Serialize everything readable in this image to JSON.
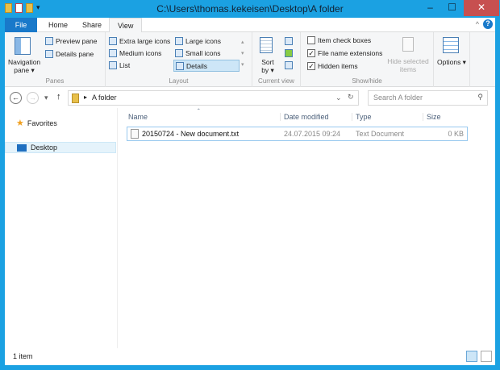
{
  "window": {
    "title": "C:\\Users\\thomas.kekeisen\\Desktop\\A folder",
    "minimize": "–",
    "maximize": "☐",
    "close": "✕"
  },
  "tabs": [
    {
      "label": "File"
    },
    {
      "label": "Home"
    },
    {
      "label": "Share"
    },
    {
      "label": "View"
    }
  ],
  "ribbon": {
    "panes": {
      "navigation_pane": "Navigation pane ▾",
      "preview_pane": "Preview pane",
      "details_pane": "Details pane",
      "label": "Panes"
    },
    "layout": {
      "items": [
        "Extra large icons",
        "Large icons",
        "Medium icons",
        "Small icons",
        "List",
        "Details"
      ],
      "selected": "Details",
      "label": "Layout"
    },
    "current_view": {
      "sort_by": "Sort by ▾",
      "label": "Current view"
    },
    "show_hide": {
      "item_check_boxes": {
        "label": "Item check boxes",
        "checked": false
      },
      "file_name_extensions": {
        "label": "File name extensions",
        "checked": true
      },
      "hidden_items": {
        "label": "Hidden items",
        "checked": true
      },
      "hide_selected": "Hide selected items",
      "label": "Show/hide"
    },
    "options": "Options ▾"
  },
  "address": {
    "path": "A folder",
    "search_placeholder": "Search A folder"
  },
  "nav": {
    "favorites": "Favorites",
    "desktop": "Desktop"
  },
  "columns": [
    "Name",
    "Date modified",
    "Type",
    "Size"
  ],
  "files": [
    {
      "name": "20150724 - New document.txt",
      "date": "24.07.2015 09:24",
      "type": "Text Document",
      "size": "0 KB"
    }
  ],
  "status": {
    "count": "1 item"
  }
}
